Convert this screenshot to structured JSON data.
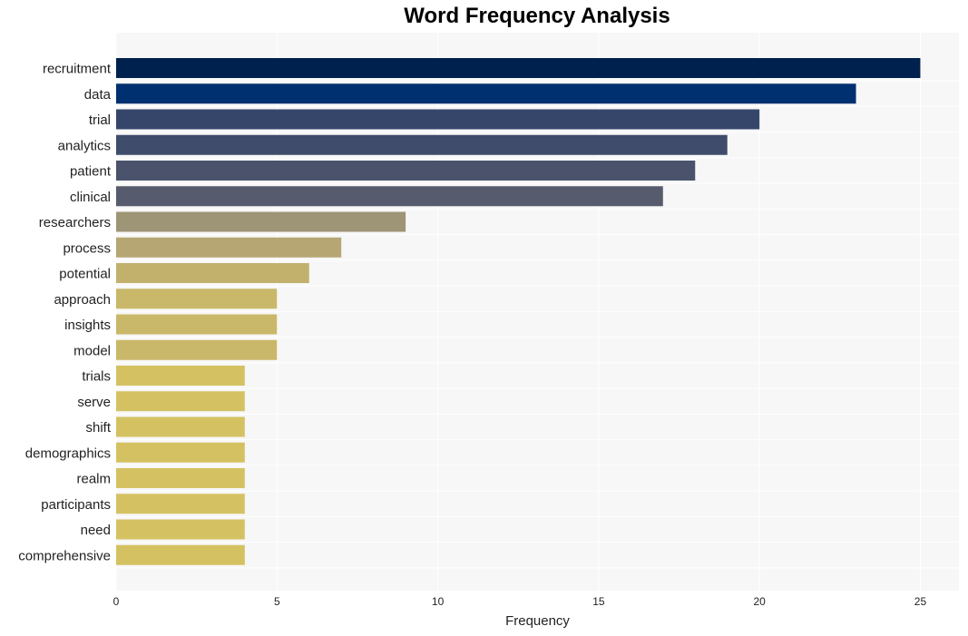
{
  "chart_data": {
    "type": "bar",
    "orientation": "horizontal",
    "title": "Word Frequency Analysis",
    "xlabel": "Frequency",
    "ylabel": "",
    "xlim": [
      0,
      26.2
    ],
    "xticks": [
      0,
      5,
      10,
      15,
      20,
      25
    ],
    "grid": true,
    "legend": "none",
    "categories": [
      "recruitment",
      "data",
      "trial",
      "analytics",
      "patient",
      "clinical",
      "researchers",
      "process",
      "potential",
      "approach",
      "insights",
      "model",
      "trials",
      "serve",
      "shift",
      "demographics",
      "realm",
      "participants",
      "need",
      "comprehensive"
    ],
    "values": [
      25,
      23,
      20,
      19,
      18,
      17,
      9,
      7,
      6,
      5,
      5,
      5,
      4,
      4,
      4,
      4,
      4,
      4,
      4,
      4
    ],
    "colors": [
      "#00214d",
      "#00306f",
      "#36466b",
      "#3f4c6b",
      "#4a536b",
      "#575b6e",
      "#9e9476",
      "#b5a673",
      "#c1b16d",
      "#c9b869",
      "#c9b869",
      "#c9b869",
      "#d4c262",
      "#d4c262",
      "#d4c262",
      "#d4c262",
      "#d4c262",
      "#d4c262",
      "#d4c262",
      "#d4c262"
    ]
  },
  "style": {
    "plot_background": "#f7f7f7",
    "grid_color": "#ffffff"
  }
}
